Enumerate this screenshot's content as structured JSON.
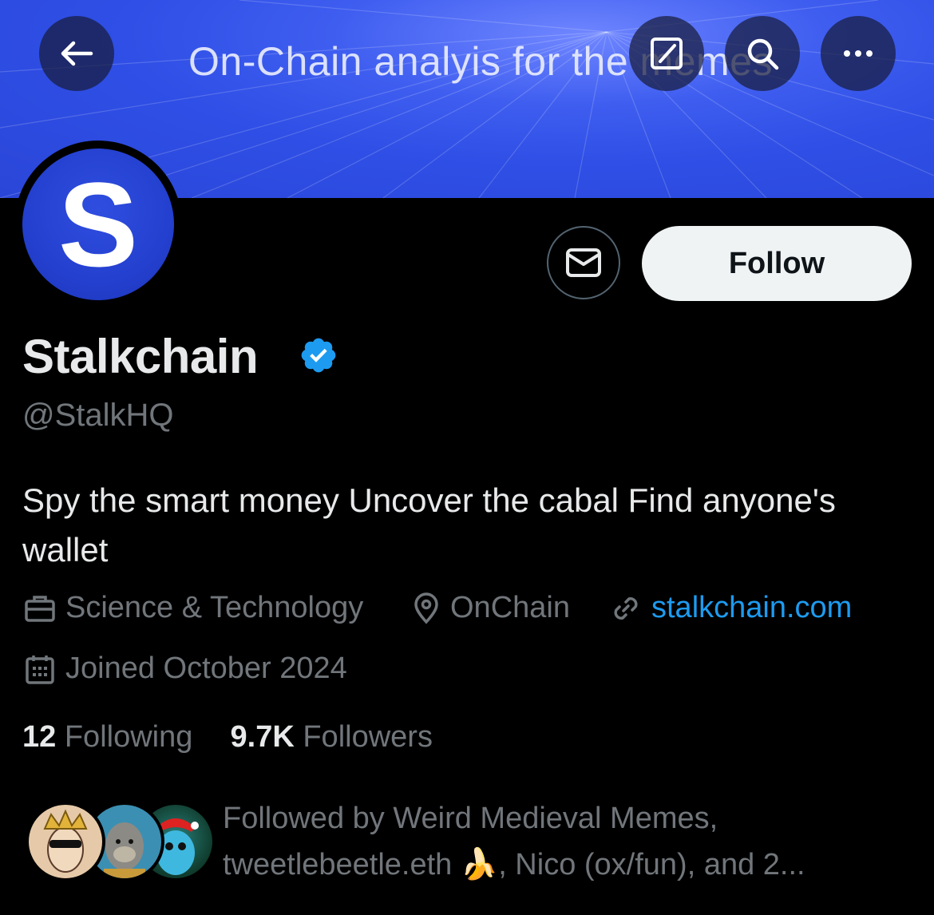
{
  "banner": {
    "title": "On-Chain analyis for the memes"
  },
  "topbar": {
    "back_icon": "arrow-left-icon",
    "edit_icon": "compose-icon",
    "search_icon": "search-icon",
    "more_icon": "more-icon"
  },
  "profile": {
    "avatar_letter": "S",
    "name": "Stalkchain",
    "handle": "@StalkHQ",
    "bio": "Spy the smart money Uncover the cabal Find anyone's wallet",
    "category": "Science & Technology",
    "location": "OnChain",
    "website": "stalkchain.com",
    "joined": "Joined October 2024"
  },
  "actions": {
    "follow_label": "Follow",
    "message_icon": "mail-icon"
  },
  "stats": {
    "following_count": "12",
    "following_label": "Following",
    "followers_count": "9.7K",
    "followers_label": "Followers"
  },
  "followed_by": {
    "line1": "Followed by Weird Medieval Memes,",
    "line2": "tweetlebeetle.eth 🍌, Nico (ox/fun), and 2..."
  },
  "colors": {
    "accent": "#1d9bf0",
    "banner": "#2f4fe6",
    "verified": "#1d9bf0"
  }
}
